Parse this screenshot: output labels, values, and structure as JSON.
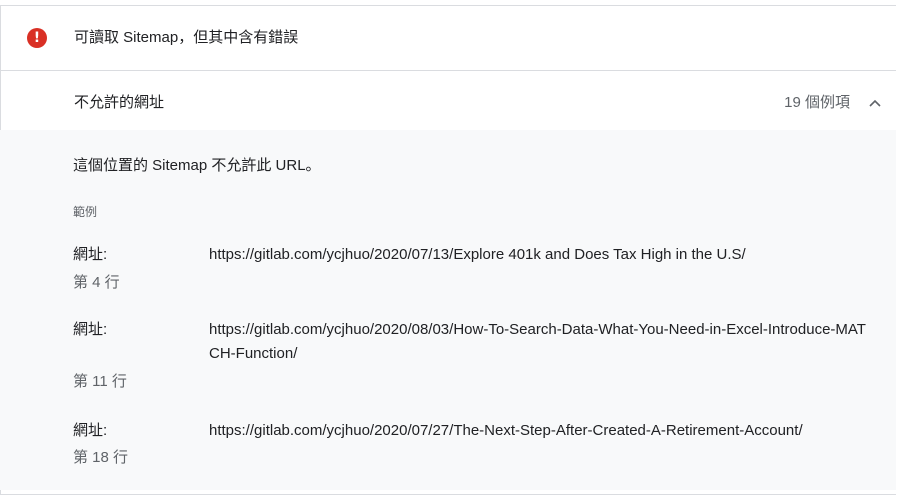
{
  "error": {
    "icon": "exclamation-icon",
    "icon_glyph": "!",
    "title": "可讀取 Sitemap，但其中含有錯誤",
    "color": "#d93025"
  },
  "issue": {
    "title": "不允許的網址",
    "count": "19 個例項",
    "chevron": "chevron-up-icon"
  },
  "details": {
    "description": "這個位置的 Sitemap 不允許此 URL。",
    "examples_label": "範例",
    "examples": [
      {
        "key": "網址:",
        "url": "https://gitlab.com/ycjhuo/2020/07/13/Explore 401k and Does Tax High in the U.S/",
        "line": "第 4 行"
      },
      {
        "key": "網址:",
        "url": "https://gitlab.com/ycjhuo/2020/08/03/How-To-Search-Data-What-You-Need-in-Excel-Introduce-MATCH-Function/",
        "line": "第 11 行"
      },
      {
        "key": "網址:",
        "url": "https://gitlab.com/ycjhuo/2020/07/27/The-Next-Step-After-Created-A-Retirement-Account/",
        "line": "第 18 行"
      }
    ]
  }
}
